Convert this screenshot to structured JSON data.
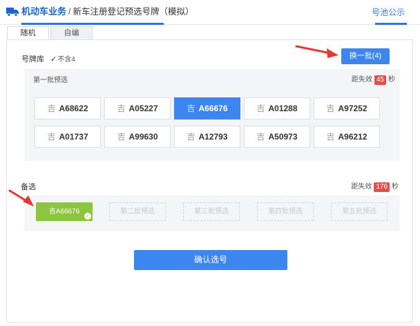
{
  "header": {
    "main_label": "机动车业务",
    "separator": "/",
    "sub_label": "新车注册登记预选号牌（模拟）",
    "pool_link": "号池公示"
  },
  "tabs": [
    {
      "label": "随机",
      "active": true
    },
    {
      "label": "自编",
      "active": false
    }
  ],
  "pool": {
    "label": "号牌库",
    "exclude_four_label": "不含4",
    "exclude_four_checked": true,
    "swap_button": "换一批(4)"
  },
  "batch": {
    "title": "第一批预选",
    "countdown_prefix": "距失效",
    "countdown_value": "45",
    "countdown_suffix": "秒",
    "plates": [
      {
        "prov": "吉",
        "num": "A68622",
        "selected": false
      },
      {
        "prov": "吉",
        "num": "A05227",
        "selected": false
      },
      {
        "prov": "吉",
        "num": "A66676",
        "selected": true
      },
      {
        "prov": "吉",
        "num": "A01288",
        "selected": false
      },
      {
        "prov": "吉",
        "num": "A97252",
        "selected": false
      },
      {
        "prov": "吉",
        "num": "A01737",
        "selected": false
      },
      {
        "prov": "吉",
        "num": "A99630",
        "selected": false
      },
      {
        "prov": "吉",
        "num": "A12793",
        "selected": false
      },
      {
        "prov": "吉",
        "num": "A50973",
        "selected": false
      },
      {
        "prov": "吉",
        "num": "A96212",
        "selected": false
      }
    ]
  },
  "alternates": {
    "label": "备选",
    "countdown_prefix": "距失效",
    "countdown_value": "176",
    "countdown_suffix": "秒",
    "slots": [
      {
        "label": "吉A66676",
        "filled": true
      },
      {
        "label": "第二批预选",
        "filled": false
      },
      {
        "label": "第三批预选",
        "filled": false
      },
      {
        "label": "第四批预选",
        "filled": false
      },
      {
        "label": "第五批预选",
        "filled": false
      }
    ]
  },
  "confirm_button": "确认选号",
  "colors": {
    "primary": "#3d86f0",
    "accent_green": "#8cc63e",
    "countdown_red": "#e64d4d",
    "annotation_red": "#e53935"
  }
}
